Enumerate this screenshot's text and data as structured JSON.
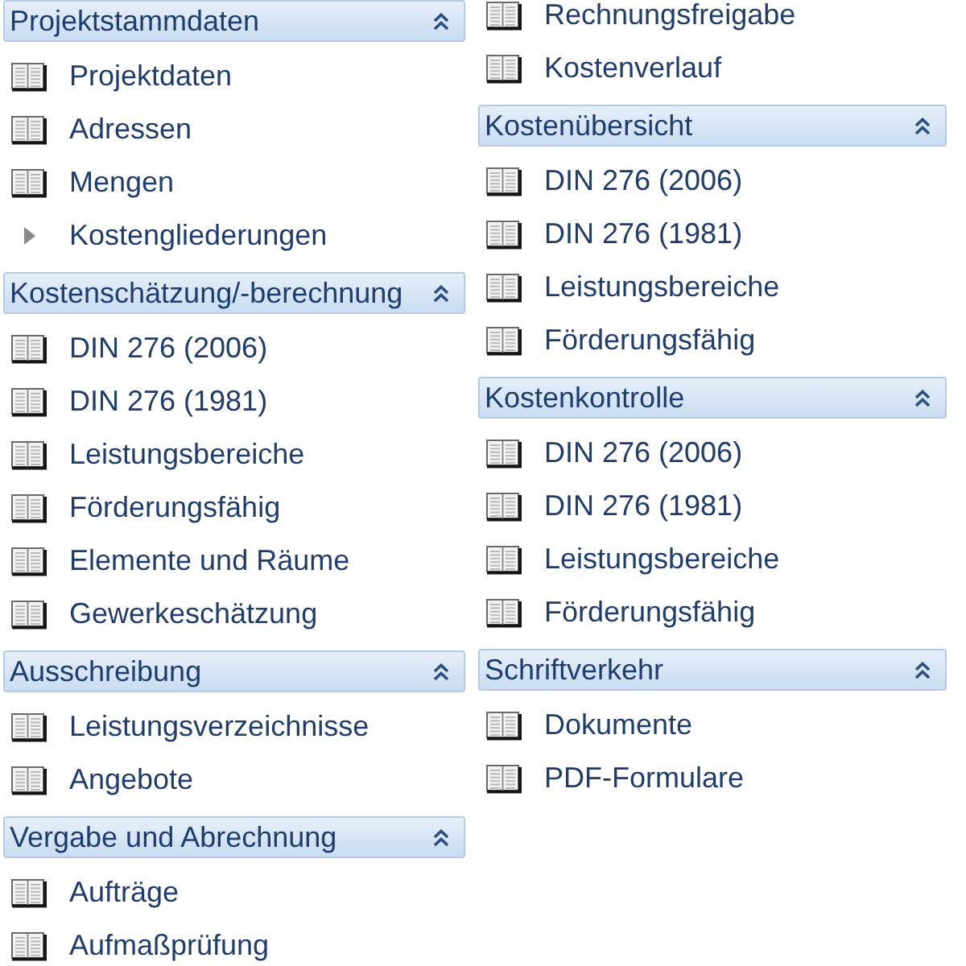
{
  "columns": [
    {
      "groups": [
        {
          "title": "Projektstammdaten",
          "expanded": true,
          "items": [
            {
              "kind": "page",
              "label": "Projektdaten"
            },
            {
              "kind": "page",
              "label": "Adressen"
            },
            {
              "kind": "page",
              "label": "Mengen"
            },
            {
              "kind": "folder",
              "label": "Kostengliederungen",
              "expanded": false
            }
          ]
        },
        {
          "title": "Kostenschätzung/-berechnung",
          "expanded": true,
          "items": [
            {
              "kind": "page",
              "label": "DIN 276 (2006)"
            },
            {
              "kind": "page",
              "label": "DIN 276 (1981)"
            },
            {
              "kind": "page",
              "label": "Leistungsbereiche"
            },
            {
              "kind": "page",
              "label": "Förderungsfähig"
            },
            {
              "kind": "page",
              "label": "Elemente und Räume"
            },
            {
              "kind": "page",
              "label": "Gewerkeschätzung"
            }
          ]
        },
        {
          "title": "Ausschreibung",
          "expanded": true,
          "items": [
            {
              "kind": "page",
              "label": "Leistungsverzeichnisse"
            },
            {
              "kind": "page",
              "label": "Angebote"
            }
          ]
        },
        {
          "title": "Vergabe und Abrechnung",
          "expanded": true,
          "items": [
            {
              "kind": "page",
              "label": "Aufträge"
            },
            {
              "kind": "page",
              "label": "Aufmaßprüfung"
            }
          ]
        }
      ]
    },
    {
      "groups": [
        {
          "items": [
            {
              "kind": "page",
              "label": "Rechnungsfreigabe"
            },
            {
              "kind": "page",
              "label": "Kostenverlauf"
            }
          ]
        },
        {
          "title": "Kostenübersicht",
          "expanded": true,
          "items": [
            {
              "kind": "page",
              "label": "DIN 276 (2006)"
            },
            {
              "kind": "page",
              "label": "DIN 276 (1981)"
            },
            {
              "kind": "page",
              "label": "Leistungsbereiche"
            },
            {
              "kind": "page",
              "label": "Förderungsfähig"
            }
          ]
        },
        {
          "title": "Kostenkontrolle",
          "expanded": true,
          "items": [
            {
              "kind": "page",
              "label": "DIN 276 (2006)"
            },
            {
              "kind": "page",
              "label": "DIN 276 (1981)"
            },
            {
              "kind": "page",
              "label": "Leistungsbereiche"
            },
            {
              "kind": "page",
              "label": "Förderungsfähig"
            }
          ]
        },
        {
          "title": "Schriftverkehr",
          "expanded": true,
          "items": [
            {
              "kind": "page",
              "label": "Dokumente"
            },
            {
              "kind": "page",
              "label": "PDF-Formulare"
            }
          ]
        }
      ]
    }
  ]
}
